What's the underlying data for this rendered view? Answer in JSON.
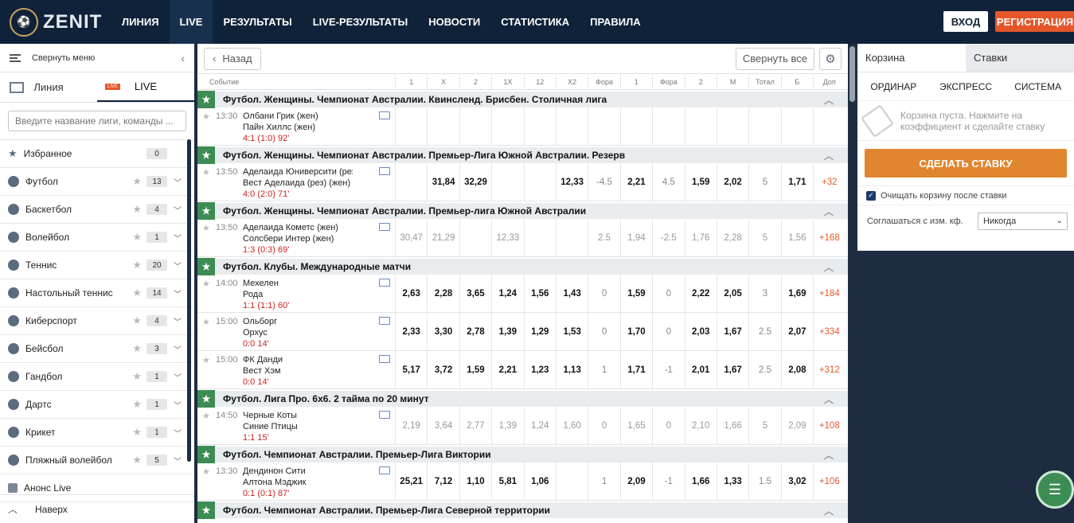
{
  "brand": {
    "name": "ZENIT"
  },
  "nav": [
    "ЛИНИЯ",
    "LIVE",
    "РЕЗУЛЬТАТЫ",
    "LIVE-РЕЗУЛЬТАТЫ",
    "НОВОСТИ",
    "СТАТИСТИКА",
    "ПРАВИЛА"
  ],
  "auth": {
    "login": "ВХОД",
    "register": "РЕГИСТРАЦИЯ"
  },
  "sidebar": {
    "collapse": "Свернуть меню",
    "tab_line": "Линия",
    "tab_live": "LIVE",
    "live_badge": "LIVE",
    "search_placeholder": "Введите название лиги, команды ...",
    "favorites": "Избранное",
    "favorites_count": "0",
    "sports": [
      {
        "name": "Футбол",
        "count": "13"
      },
      {
        "name": "Баскетбол",
        "count": "4"
      },
      {
        "name": "Волейбол",
        "count": "1"
      },
      {
        "name": "Теннис",
        "count": "20"
      },
      {
        "name": "Настольный теннис",
        "count": "14"
      },
      {
        "name": "Киберспорт",
        "count": "4"
      },
      {
        "name": "Бейсбол",
        "count": "3"
      },
      {
        "name": "Гандбол",
        "count": "1"
      },
      {
        "name": "Дартс",
        "count": "1"
      },
      {
        "name": "Крикет",
        "count": "1"
      },
      {
        "name": "Пляжный волейбол",
        "count": "5"
      }
    ],
    "announce": "Анонс Live",
    "up": "Наверх"
  },
  "main": {
    "back": "Назад",
    "collapse_all": "Свернуть все",
    "columns": [
      "Событие",
      "1",
      "X",
      "2",
      "1X",
      "12",
      "X2",
      "Фора",
      "1",
      "Фора",
      "2",
      "М",
      "Тотал",
      "Б",
      "Доп"
    ]
  },
  "leagues": [
    {
      "title": "Футбол. Женщины. Чемпионат Австралии. Квинсленд. Брисбен. Столичная лига",
      "matches": [
        {
          "time": "13:30",
          "team1": "Олбани Грик (жен)",
          "team2": "Пайн Хиллс (жен)",
          "score": "4:1 (1:0) 92'",
          "odds": [
            "",
            "",
            "",
            "",
            "",
            "",
            "",
            "",
            "",
            "",
            "",
            "",
            "",
            "",
            ""
          ],
          "style": "bold"
        }
      ]
    },
    {
      "title": "Футбол. Женщины. Чемпионат Австралии. Премьер-Лига Южной Австралии. Резерв",
      "matches": [
        {
          "time": "13:50",
          "team1": "Аделаида Юниверсити (рез)",
          "team2": "Вест Аделаида (рез) (жен)",
          "score": "4:0 (2:0) 71'",
          "odds": [
            "",
            "31,84",
            "32,29",
            "",
            "",
            "12,33",
            "-4.5",
            "2,21",
            "4.5",
            "1,59",
            "2,02",
            "5",
            "1,71",
            "+32"
          ],
          "style": "bold"
        }
      ]
    },
    {
      "title": "Футбол. Женщины. Чемпионат Австралии. Премьер-лига Южной Австралии",
      "matches": [
        {
          "time": "13:50",
          "team1": "Аделаида Кометс (жен)",
          "team2": "Солсбери Интер (жен)",
          "score": "1:3 (0:3) 69'",
          "odds": [
            "30,47",
            "21,29",
            "",
            "12,33",
            "",
            "",
            "2.5",
            "1,94",
            "-2.5",
            "1,76",
            "2,28",
            "5",
            "1,56",
            "+168"
          ],
          "style": "dim"
        }
      ]
    },
    {
      "title": "Футбол. Клубы. Международные матчи",
      "matches": [
        {
          "time": "14:00",
          "team1": "Мехелен",
          "team2": "Рода",
          "score": "1:1 (1:1) 60'",
          "odds": [
            "2,63",
            "2,28",
            "3,65",
            "1,24",
            "1,56",
            "1,43",
            "0",
            "1,59",
            "0",
            "2,22",
            "2,05",
            "3",
            "1,69",
            "+184"
          ],
          "style": "bold"
        },
        {
          "time": "15:00",
          "team1": "Ольборг",
          "team2": "Орхус",
          "score": "0:0 14'",
          "odds": [
            "2,33",
            "3,30",
            "2,78",
            "1,39",
            "1,29",
            "1,53",
            "0",
            "1,70",
            "0",
            "2,03",
            "1,67",
            "2.5",
            "2,07",
            "+334"
          ],
          "style": "bold"
        },
        {
          "time": "15:00",
          "team1": "ФК Данди",
          "team2": "Вест Хэм",
          "score": "0:0 14'",
          "odds": [
            "5,17",
            "3,72",
            "1,59",
            "2,21",
            "1,23",
            "1,13",
            "1",
            "1,71",
            "-1",
            "2,01",
            "1,67",
            "2.5",
            "2,08",
            "+312"
          ],
          "style": "bold"
        }
      ]
    },
    {
      "title": "Футбол. Лига Про. 6х6. 2 тайма по 20 минут",
      "matches": [
        {
          "time": "14:50",
          "team1": "Черные Коты",
          "team2": "Синие Птицы",
          "score": "1:1 15'",
          "odds": [
            "2,19",
            "3,64",
            "2,77",
            "1,39",
            "1,24",
            "1,60",
            "0",
            "1,65",
            "0",
            "2,10",
            "1,66",
            "5",
            "2,09",
            "+108"
          ],
          "style": "dim"
        }
      ]
    },
    {
      "title": "Футбол. Чемпионат Австралии. Премьер-Лига Виктории",
      "matches": [
        {
          "time": "13:30",
          "team1": "Дендинон Сити",
          "team2": "Алтона Мэджик",
          "score": "0:1 (0:1) 87'",
          "odds": [
            "25,21",
            "7,12",
            "1,10",
            "5,81",
            "1,06",
            "",
            "1",
            "2,09",
            "-1",
            "1,66",
            "1,33",
            "1.5",
            "3,02",
            "+106"
          ],
          "style": "bold"
        }
      ]
    },
    {
      "title": "Футбол. Чемпионат Австралии. Премьер-Лига Северной территории",
      "matches": []
    }
  ],
  "betslip": {
    "tab_cart": "Корзина",
    "tab_bets": "Ставки",
    "modes": [
      "ОРДИНАР",
      "ЭКСПРЕСС",
      "СИСТЕМА"
    ],
    "empty": "Корзина пуста. Нажмите на коэффициент и сделайте ставку",
    "make_bet": "СДЕЛАТЬ СТАВКУ",
    "clear_after": "Очищать корзину после ставки",
    "agree": "Соглашаться с изм. кф.",
    "agree_value": "Никогда"
  }
}
